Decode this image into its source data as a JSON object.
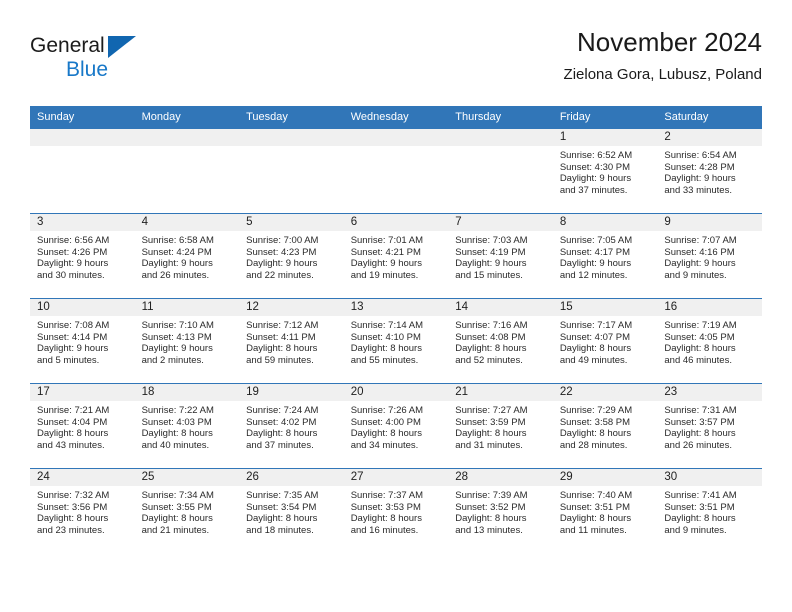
{
  "brand": {
    "name_part1": "General",
    "name_part2": "Blue",
    "triangle_color": "#1166b0",
    "blue_color": "#1878c8"
  },
  "header": {
    "title": "November 2024",
    "subtitle": "Zielona Gora, Lubusz, Poland"
  },
  "theme": {
    "header_bg": "#3176b8",
    "header_text": "#ffffff",
    "date_strip_bg": "#f0f0f0",
    "cell_bg": "#ffffff",
    "row_border": "#3176b8"
  },
  "weekday_headers": [
    "Sunday",
    "Monday",
    "Tuesday",
    "Wednesday",
    "Thursday",
    "Friday",
    "Saturday"
  ],
  "labels": {
    "sunrise_prefix": "Sunrise: ",
    "sunset_prefix": "Sunset: ",
    "daylight_prefix": "Daylight: "
  },
  "weeks": [
    [
      {
        "empty": true,
        "day": "",
        "sunrise": "",
        "sunset": "",
        "daylight_line1": "",
        "daylight_line2": ""
      },
      {
        "empty": true,
        "day": "",
        "sunrise": "",
        "sunset": "",
        "daylight_line1": "",
        "daylight_line2": ""
      },
      {
        "empty": true,
        "day": "",
        "sunrise": "",
        "sunset": "",
        "daylight_line1": "",
        "daylight_line2": ""
      },
      {
        "empty": true,
        "day": "",
        "sunrise": "",
        "sunset": "",
        "daylight_line1": "",
        "daylight_line2": ""
      },
      {
        "empty": true,
        "day": "",
        "sunrise": "",
        "sunset": "",
        "daylight_line1": "",
        "daylight_line2": ""
      },
      {
        "empty": false,
        "day": "1",
        "sunrise": "Sunrise: 6:52 AM",
        "sunset": "Sunset: 4:30 PM",
        "daylight_line1": "Daylight: 9 hours",
        "daylight_line2": "and 37 minutes."
      },
      {
        "empty": false,
        "day": "2",
        "sunrise": "Sunrise: 6:54 AM",
        "sunset": "Sunset: 4:28 PM",
        "daylight_line1": "Daylight: 9 hours",
        "daylight_line2": "and 33 minutes."
      }
    ],
    [
      {
        "empty": false,
        "day": "3",
        "sunrise": "Sunrise: 6:56 AM",
        "sunset": "Sunset: 4:26 PM",
        "daylight_line1": "Daylight: 9 hours",
        "daylight_line2": "and 30 minutes."
      },
      {
        "empty": false,
        "day": "4",
        "sunrise": "Sunrise: 6:58 AM",
        "sunset": "Sunset: 4:24 PM",
        "daylight_line1": "Daylight: 9 hours",
        "daylight_line2": "and 26 minutes."
      },
      {
        "empty": false,
        "day": "5",
        "sunrise": "Sunrise: 7:00 AM",
        "sunset": "Sunset: 4:23 PM",
        "daylight_line1": "Daylight: 9 hours",
        "daylight_line2": "and 22 minutes."
      },
      {
        "empty": false,
        "day": "6",
        "sunrise": "Sunrise: 7:01 AM",
        "sunset": "Sunset: 4:21 PM",
        "daylight_line1": "Daylight: 9 hours",
        "daylight_line2": "and 19 minutes."
      },
      {
        "empty": false,
        "day": "7",
        "sunrise": "Sunrise: 7:03 AM",
        "sunset": "Sunset: 4:19 PM",
        "daylight_line1": "Daylight: 9 hours",
        "daylight_line2": "and 15 minutes."
      },
      {
        "empty": false,
        "day": "8",
        "sunrise": "Sunrise: 7:05 AM",
        "sunset": "Sunset: 4:17 PM",
        "daylight_line1": "Daylight: 9 hours",
        "daylight_line2": "and 12 minutes."
      },
      {
        "empty": false,
        "day": "9",
        "sunrise": "Sunrise: 7:07 AM",
        "sunset": "Sunset: 4:16 PM",
        "daylight_line1": "Daylight: 9 hours",
        "daylight_line2": "and 9 minutes."
      }
    ],
    [
      {
        "empty": false,
        "day": "10",
        "sunrise": "Sunrise: 7:08 AM",
        "sunset": "Sunset: 4:14 PM",
        "daylight_line1": "Daylight: 9 hours",
        "daylight_line2": "and 5 minutes."
      },
      {
        "empty": false,
        "day": "11",
        "sunrise": "Sunrise: 7:10 AM",
        "sunset": "Sunset: 4:13 PM",
        "daylight_line1": "Daylight: 9 hours",
        "daylight_line2": "and 2 minutes."
      },
      {
        "empty": false,
        "day": "12",
        "sunrise": "Sunrise: 7:12 AM",
        "sunset": "Sunset: 4:11 PM",
        "daylight_line1": "Daylight: 8 hours",
        "daylight_line2": "and 59 minutes."
      },
      {
        "empty": false,
        "day": "13",
        "sunrise": "Sunrise: 7:14 AM",
        "sunset": "Sunset: 4:10 PM",
        "daylight_line1": "Daylight: 8 hours",
        "daylight_line2": "and 55 minutes."
      },
      {
        "empty": false,
        "day": "14",
        "sunrise": "Sunrise: 7:16 AM",
        "sunset": "Sunset: 4:08 PM",
        "daylight_line1": "Daylight: 8 hours",
        "daylight_line2": "and 52 minutes."
      },
      {
        "empty": false,
        "day": "15",
        "sunrise": "Sunrise: 7:17 AM",
        "sunset": "Sunset: 4:07 PM",
        "daylight_line1": "Daylight: 8 hours",
        "daylight_line2": "and 49 minutes."
      },
      {
        "empty": false,
        "day": "16",
        "sunrise": "Sunrise: 7:19 AM",
        "sunset": "Sunset: 4:05 PM",
        "daylight_line1": "Daylight: 8 hours",
        "daylight_line2": "and 46 minutes."
      }
    ],
    [
      {
        "empty": false,
        "day": "17",
        "sunrise": "Sunrise: 7:21 AM",
        "sunset": "Sunset: 4:04 PM",
        "daylight_line1": "Daylight: 8 hours",
        "daylight_line2": "and 43 minutes."
      },
      {
        "empty": false,
        "day": "18",
        "sunrise": "Sunrise: 7:22 AM",
        "sunset": "Sunset: 4:03 PM",
        "daylight_line1": "Daylight: 8 hours",
        "daylight_line2": "and 40 minutes."
      },
      {
        "empty": false,
        "day": "19",
        "sunrise": "Sunrise: 7:24 AM",
        "sunset": "Sunset: 4:02 PM",
        "daylight_line1": "Daylight: 8 hours",
        "daylight_line2": "and 37 minutes."
      },
      {
        "empty": false,
        "day": "20",
        "sunrise": "Sunrise: 7:26 AM",
        "sunset": "Sunset: 4:00 PM",
        "daylight_line1": "Daylight: 8 hours",
        "daylight_line2": "and 34 minutes."
      },
      {
        "empty": false,
        "day": "21",
        "sunrise": "Sunrise: 7:27 AM",
        "sunset": "Sunset: 3:59 PM",
        "daylight_line1": "Daylight: 8 hours",
        "daylight_line2": "and 31 minutes."
      },
      {
        "empty": false,
        "day": "22",
        "sunrise": "Sunrise: 7:29 AM",
        "sunset": "Sunset: 3:58 PM",
        "daylight_line1": "Daylight: 8 hours",
        "daylight_line2": "and 28 minutes."
      },
      {
        "empty": false,
        "day": "23",
        "sunrise": "Sunrise: 7:31 AM",
        "sunset": "Sunset: 3:57 PM",
        "daylight_line1": "Daylight: 8 hours",
        "daylight_line2": "and 26 minutes."
      }
    ],
    [
      {
        "empty": false,
        "day": "24",
        "sunrise": "Sunrise: 7:32 AM",
        "sunset": "Sunset: 3:56 PM",
        "daylight_line1": "Daylight: 8 hours",
        "daylight_line2": "and 23 minutes."
      },
      {
        "empty": false,
        "day": "25",
        "sunrise": "Sunrise: 7:34 AM",
        "sunset": "Sunset: 3:55 PM",
        "daylight_line1": "Daylight: 8 hours",
        "daylight_line2": "and 21 minutes."
      },
      {
        "empty": false,
        "day": "26",
        "sunrise": "Sunrise: 7:35 AM",
        "sunset": "Sunset: 3:54 PM",
        "daylight_line1": "Daylight: 8 hours",
        "daylight_line2": "and 18 minutes."
      },
      {
        "empty": false,
        "day": "27",
        "sunrise": "Sunrise: 7:37 AM",
        "sunset": "Sunset: 3:53 PM",
        "daylight_line1": "Daylight: 8 hours",
        "daylight_line2": "and 16 minutes."
      },
      {
        "empty": false,
        "day": "28",
        "sunrise": "Sunrise: 7:39 AM",
        "sunset": "Sunset: 3:52 PM",
        "daylight_line1": "Daylight: 8 hours",
        "daylight_line2": "and 13 minutes."
      },
      {
        "empty": false,
        "day": "29",
        "sunrise": "Sunrise: 7:40 AM",
        "sunset": "Sunset: 3:51 PM",
        "daylight_line1": "Daylight: 8 hours",
        "daylight_line2": "and 11 minutes."
      },
      {
        "empty": false,
        "day": "30",
        "sunrise": "Sunrise: 7:41 AM",
        "sunset": "Sunset: 3:51 PM",
        "daylight_line1": "Daylight: 8 hours",
        "daylight_line2": "and 9 minutes."
      }
    ]
  ]
}
